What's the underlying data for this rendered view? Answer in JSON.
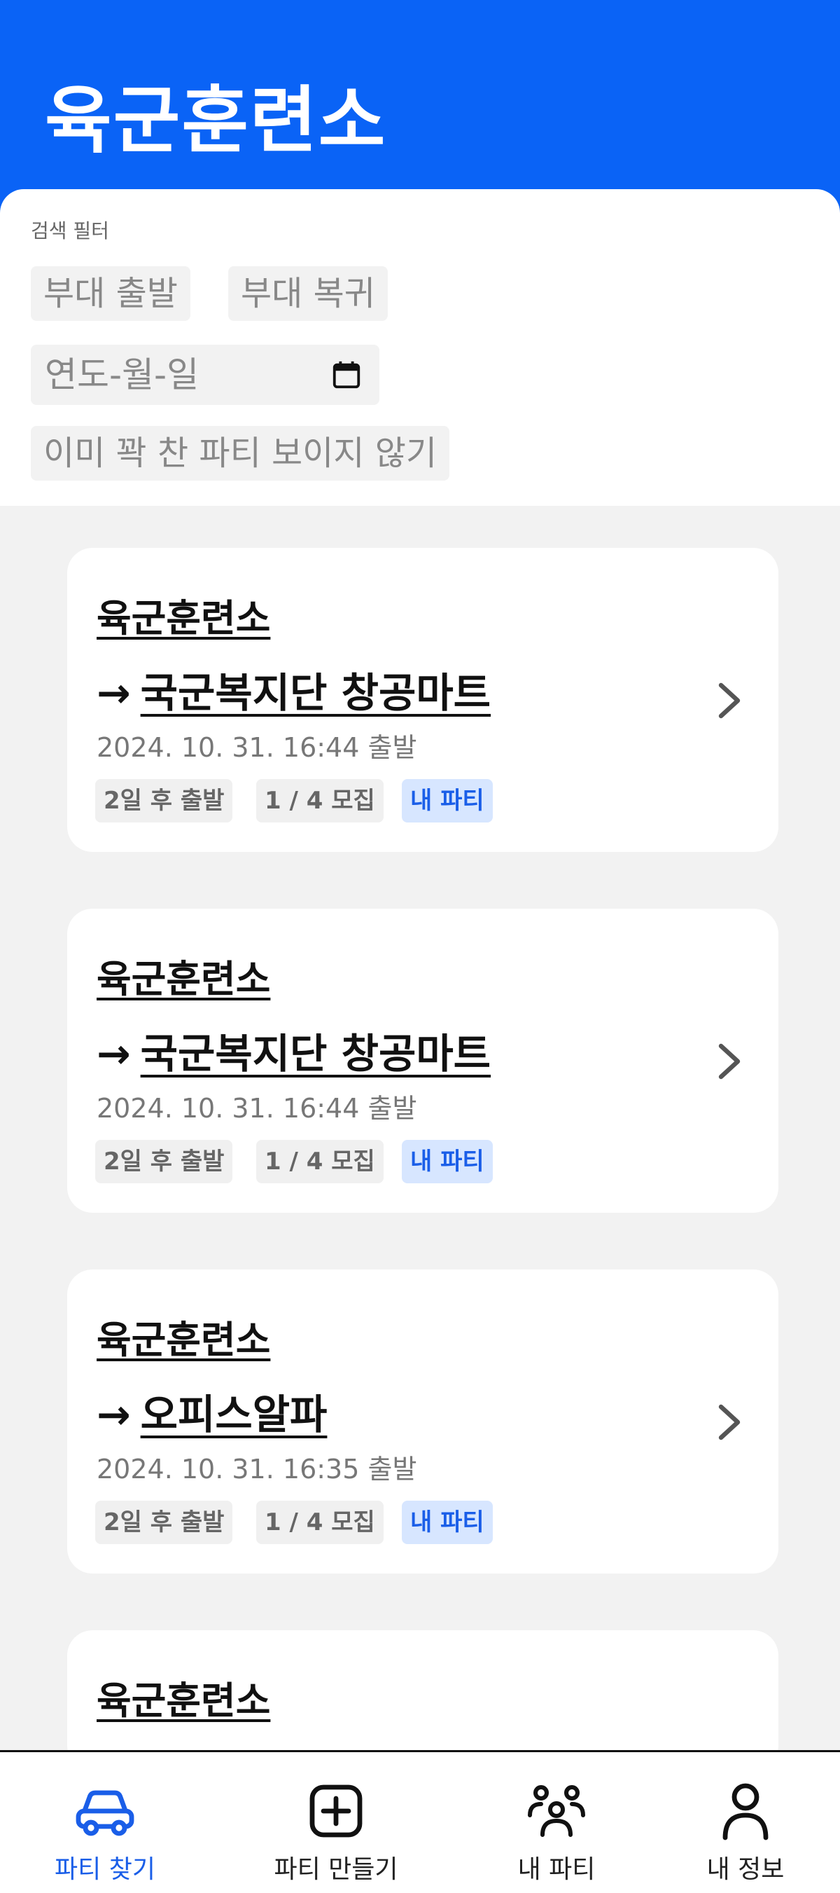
{
  "header": {
    "title": "육군훈련소"
  },
  "filter": {
    "label": "검색 필터",
    "chips": [
      "부대 출발",
      "부대 복귀"
    ],
    "date_placeholder": "연도-월-일",
    "hide_full_label": "이미 꽉 찬 파티 보이지 않기"
  },
  "cards": [
    {
      "origin": "육군훈련소",
      "arrow": "→",
      "destination": "국군복지단 창공마트",
      "datetime": "2024. 10. 31. 16:44 출발",
      "badges": [
        "2일 후 출발",
        "1 / 4 모집",
        "내 파티"
      ]
    },
    {
      "origin": "육군훈련소",
      "arrow": "→",
      "destination": "국군복지단 창공마트",
      "datetime": "2024. 10. 31. 16:44 출발",
      "badges": [
        "2일 후 출발",
        "1 / 4 모집",
        "내 파티"
      ]
    },
    {
      "origin": "육군훈련소",
      "arrow": "→",
      "destination": "오피스알파",
      "datetime": "2024. 10. 31. 16:35 출발",
      "badges": [
        "2일 후 출발",
        "1 / 4 모집",
        "내 파티"
      ]
    },
    {
      "origin": "육군훈련소"
    }
  ],
  "nav": {
    "items": [
      {
        "label": "파티 찾기",
        "icon": "car-icon",
        "active": true
      },
      {
        "label": "파티 만들기",
        "icon": "plus-square-icon",
        "active": false
      },
      {
        "label": "내 파티",
        "icon": "group-icon",
        "active": false
      },
      {
        "label": "내 정보",
        "icon": "person-icon",
        "active": false
      }
    ]
  },
  "colors": {
    "accent": "#0a63f6",
    "badge_blue_bg": "#d7e6ff",
    "badge_blue_text": "#1a5ee8"
  }
}
